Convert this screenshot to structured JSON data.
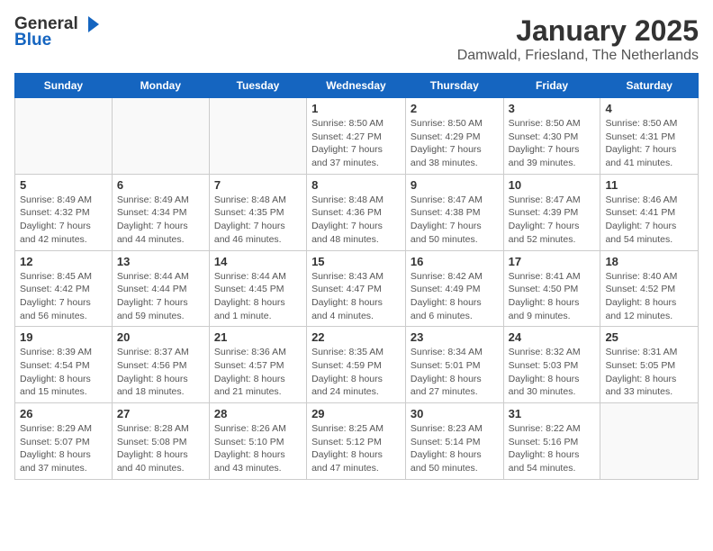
{
  "header": {
    "logo_general": "General",
    "logo_blue": "Blue",
    "month_title": "January 2025",
    "location": "Damwald, Friesland, The Netherlands"
  },
  "days_of_week": [
    "Sunday",
    "Monday",
    "Tuesday",
    "Wednesday",
    "Thursday",
    "Friday",
    "Saturday"
  ],
  "weeks": [
    [
      {
        "day": "",
        "empty": true
      },
      {
        "day": "",
        "empty": true
      },
      {
        "day": "",
        "empty": true
      },
      {
        "day": "1",
        "sunrise": "Sunrise: 8:50 AM",
        "sunset": "Sunset: 4:27 PM",
        "daylight": "Daylight: 7 hours and 37 minutes."
      },
      {
        "day": "2",
        "sunrise": "Sunrise: 8:50 AM",
        "sunset": "Sunset: 4:29 PM",
        "daylight": "Daylight: 7 hours and 38 minutes."
      },
      {
        "day": "3",
        "sunrise": "Sunrise: 8:50 AM",
        "sunset": "Sunset: 4:30 PM",
        "daylight": "Daylight: 7 hours and 39 minutes."
      },
      {
        "day": "4",
        "sunrise": "Sunrise: 8:50 AM",
        "sunset": "Sunset: 4:31 PM",
        "daylight": "Daylight: 7 hours and 41 minutes."
      }
    ],
    [
      {
        "day": "5",
        "sunrise": "Sunrise: 8:49 AM",
        "sunset": "Sunset: 4:32 PM",
        "daylight": "Daylight: 7 hours and 42 minutes."
      },
      {
        "day": "6",
        "sunrise": "Sunrise: 8:49 AM",
        "sunset": "Sunset: 4:34 PM",
        "daylight": "Daylight: 7 hours and 44 minutes."
      },
      {
        "day": "7",
        "sunrise": "Sunrise: 8:48 AM",
        "sunset": "Sunset: 4:35 PM",
        "daylight": "Daylight: 7 hours and 46 minutes."
      },
      {
        "day": "8",
        "sunrise": "Sunrise: 8:48 AM",
        "sunset": "Sunset: 4:36 PM",
        "daylight": "Daylight: 7 hours and 48 minutes."
      },
      {
        "day": "9",
        "sunrise": "Sunrise: 8:47 AM",
        "sunset": "Sunset: 4:38 PM",
        "daylight": "Daylight: 7 hours and 50 minutes."
      },
      {
        "day": "10",
        "sunrise": "Sunrise: 8:47 AM",
        "sunset": "Sunset: 4:39 PM",
        "daylight": "Daylight: 7 hours and 52 minutes."
      },
      {
        "day": "11",
        "sunrise": "Sunrise: 8:46 AM",
        "sunset": "Sunset: 4:41 PM",
        "daylight": "Daylight: 7 hours and 54 minutes."
      }
    ],
    [
      {
        "day": "12",
        "sunrise": "Sunrise: 8:45 AM",
        "sunset": "Sunset: 4:42 PM",
        "daylight": "Daylight: 7 hours and 56 minutes."
      },
      {
        "day": "13",
        "sunrise": "Sunrise: 8:44 AM",
        "sunset": "Sunset: 4:44 PM",
        "daylight": "Daylight: 7 hours and 59 minutes."
      },
      {
        "day": "14",
        "sunrise": "Sunrise: 8:44 AM",
        "sunset": "Sunset: 4:45 PM",
        "daylight": "Daylight: 8 hours and 1 minute."
      },
      {
        "day": "15",
        "sunrise": "Sunrise: 8:43 AM",
        "sunset": "Sunset: 4:47 PM",
        "daylight": "Daylight: 8 hours and 4 minutes."
      },
      {
        "day": "16",
        "sunrise": "Sunrise: 8:42 AM",
        "sunset": "Sunset: 4:49 PM",
        "daylight": "Daylight: 8 hours and 6 minutes."
      },
      {
        "day": "17",
        "sunrise": "Sunrise: 8:41 AM",
        "sunset": "Sunset: 4:50 PM",
        "daylight": "Daylight: 8 hours and 9 minutes."
      },
      {
        "day": "18",
        "sunrise": "Sunrise: 8:40 AM",
        "sunset": "Sunset: 4:52 PM",
        "daylight": "Daylight: 8 hours and 12 minutes."
      }
    ],
    [
      {
        "day": "19",
        "sunrise": "Sunrise: 8:39 AM",
        "sunset": "Sunset: 4:54 PM",
        "daylight": "Daylight: 8 hours and 15 minutes."
      },
      {
        "day": "20",
        "sunrise": "Sunrise: 8:37 AM",
        "sunset": "Sunset: 4:56 PM",
        "daylight": "Daylight: 8 hours and 18 minutes."
      },
      {
        "day": "21",
        "sunrise": "Sunrise: 8:36 AM",
        "sunset": "Sunset: 4:57 PM",
        "daylight": "Daylight: 8 hours and 21 minutes."
      },
      {
        "day": "22",
        "sunrise": "Sunrise: 8:35 AM",
        "sunset": "Sunset: 4:59 PM",
        "daylight": "Daylight: 8 hours and 24 minutes."
      },
      {
        "day": "23",
        "sunrise": "Sunrise: 8:34 AM",
        "sunset": "Sunset: 5:01 PM",
        "daylight": "Daylight: 8 hours and 27 minutes."
      },
      {
        "day": "24",
        "sunrise": "Sunrise: 8:32 AM",
        "sunset": "Sunset: 5:03 PM",
        "daylight": "Daylight: 8 hours and 30 minutes."
      },
      {
        "day": "25",
        "sunrise": "Sunrise: 8:31 AM",
        "sunset": "Sunset: 5:05 PM",
        "daylight": "Daylight: 8 hours and 33 minutes."
      }
    ],
    [
      {
        "day": "26",
        "sunrise": "Sunrise: 8:29 AM",
        "sunset": "Sunset: 5:07 PM",
        "daylight": "Daylight: 8 hours and 37 minutes."
      },
      {
        "day": "27",
        "sunrise": "Sunrise: 8:28 AM",
        "sunset": "Sunset: 5:08 PM",
        "daylight": "Daylight: 8 hours and 40 minutes."
      },
      {
        "day": "28",
        "sunrise": "Sunrise: 8:26 AM",
        "sunset": "Sunset: 5:10 PM",
        "daylight": "Daylight: 8 hours and 43 minutes."
      },
      {
        "day": "29",
        "sunrise": "Sunrise: 8:25 AM",
        "sunset": "Sunset: 5:12 PM",
        "daylight": "Daylight: 8 hours and 47 minutes."
      },
      {
        "day": "30",
        "sunrise": "Sunrise: 8:23 AM",
        "sunset": "Sunset: 5:14 PM",
        "daylight": "Daylight: 8 hours and 50 minutes."
      },
      {
        "day": "31",
        "sunrise": "Sunrise: 8:22 AM",
        "sunset": "Sunset: 5:16 PM",
        "daylight": "Daylight: 8 hours and 54 minutes."
      },
      {
        "day": "",
        "empty": true
      }
    ]
  ]
}
